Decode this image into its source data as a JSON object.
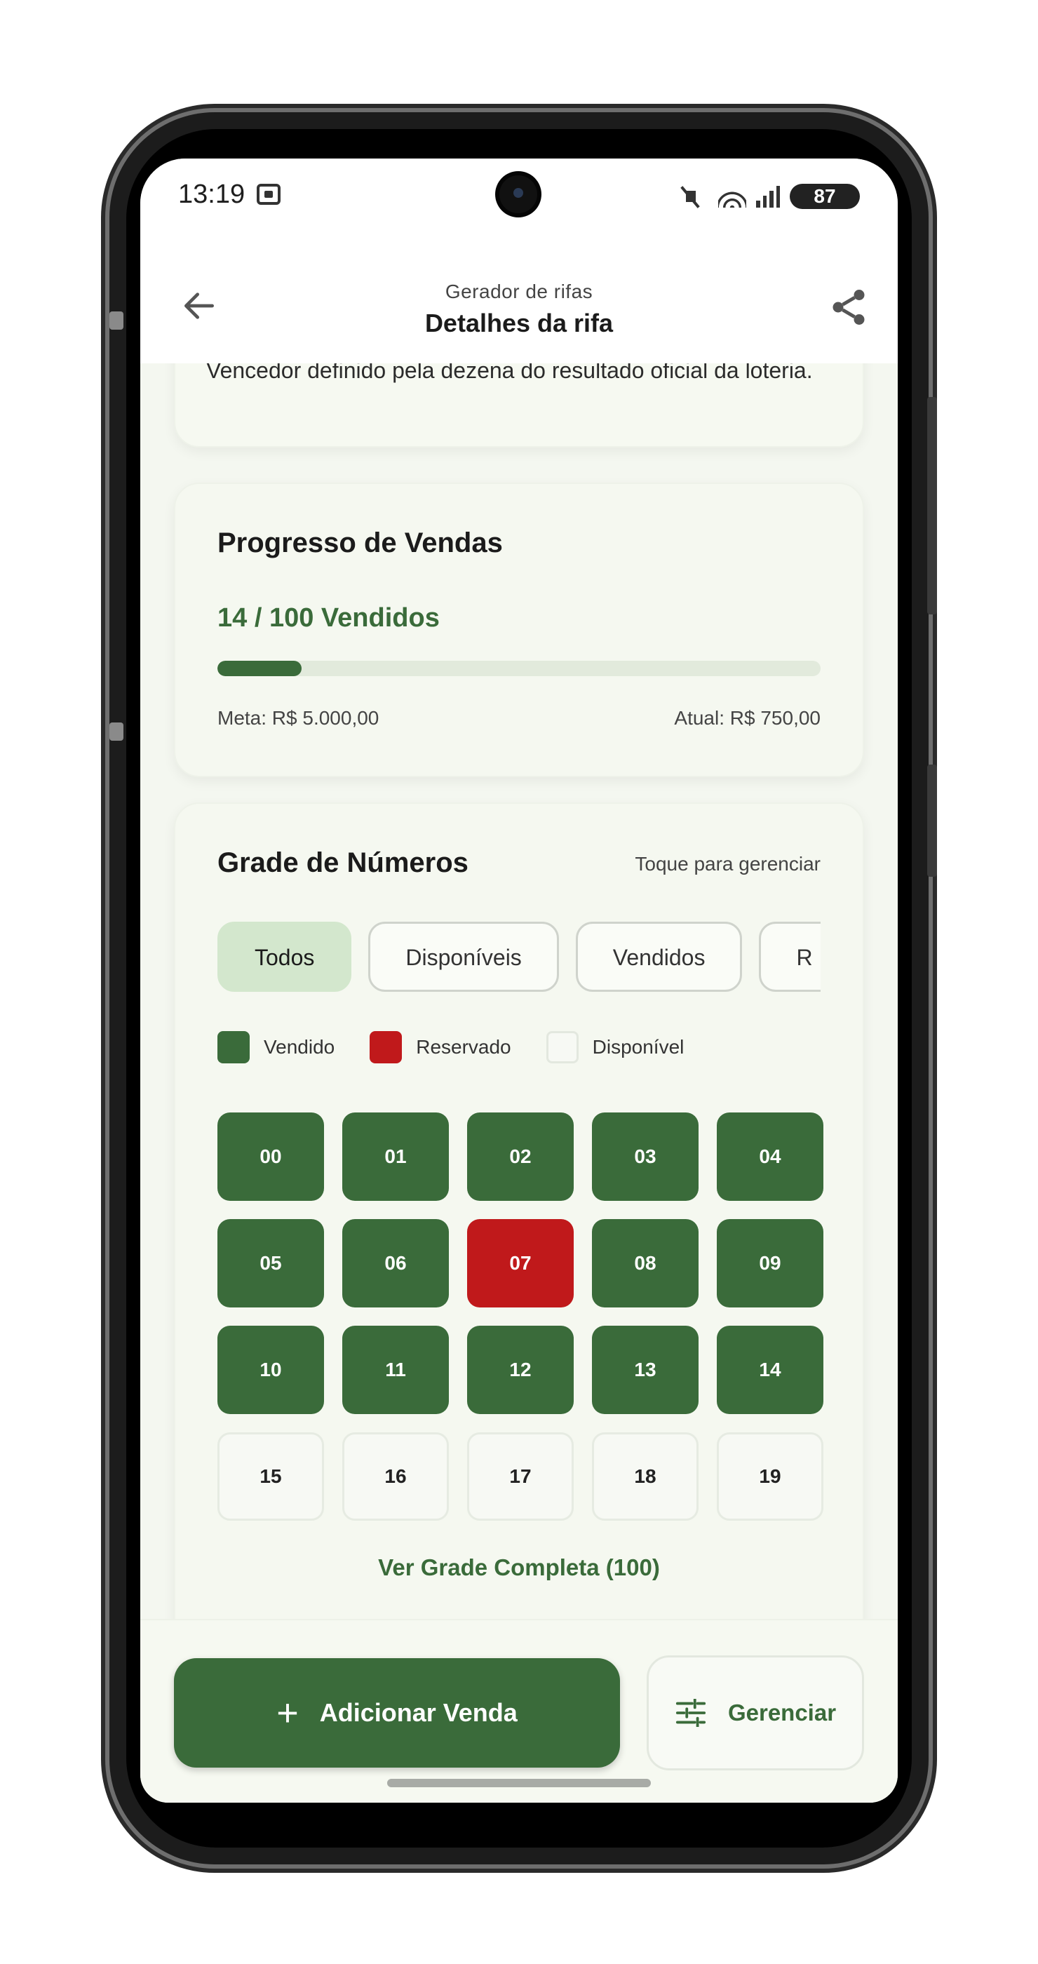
{
  "status_bar": {
    "time": "13:19",
    "battery": "87",
    "icons": [
      "screen-record-icon",
      "mute-icon",
      "wifi-icon",
      "signal-icon",
      "battery-icon"
    ]
  },
  "app_bar": {
    "subtitle": "Gerador de rifas",
    "title": "Detalhes da rifa",
    "back_icon": "arrow-left-icon",
    "share_icon": "share-icon"
  },
  "description": {
    "text": "Vencedor definido pela dezena do resultado oficial da loteria."
  },
  "progress": {
    "title": "Progresso de Vendas",
    "count_label": "14 / 100 Vendidos",
    "sold": 14,
    "total": 100,
    "goal_label": "Meta: R$ 5.000,00",
    "current_label": "Atual: R$ 750,00"
  },
  "grid": {
    "title": "Grade de Números",
    "hint": "Toque para gerenciar",
    "filters": [
      "Todos",
      "Disponíveis",
      "Vendidos",
      "R"
    ],
    "active_filter": "Todos",
    "legend": [
      {
        "label": "Vendido",
        "color": "#3a6b3a"
      },
      {
        "label": "Reservado",
        "color": "#c0191b"
      },
      {
        "label": "Disponível",
        "color": "#f7f9f4"
      }
    ],
    "numbers": [
      {
        "n": "00",
        "status": "sold"
      },
      {
        "n": "01",
        "status": "sold"
      },
      {
        "n": "02",
        "status": "sold"
      },
      {
        "n": "03",
        "status": "sold"
      },
      {
        "n": "04",
        "status": "sold"
      },
      {
        "n": "05",
        "status": "sold"
      },
      {
        "n": "06",
        "status": "sold"
      },
      {
        "n": "07",
        "status": "reserved"
      },
      {
        "n": "08",
        "status": "sold"
      },
      {
        "n": "09",
        "status": "sold"
      },
      {
        "n": "10",
        "status": "sold"
      },
      {
        "n": "11",
        "status": "sold"
      },
      {
        "n": "12",
        "status": "sold"
      },
      {
        "n": "13",
        "status": "sold"
      },
      {
        "n": "14",
        "status": "sold"
      },
      {
        "n": "15",
        "status": "available"
      },
      {
        "n": "16",
        "status": "available"
      },
      {
        "n": "17",
        "status": "available"
      },
      {
        "n": "18",
        "status": "available"
      },
      {
        "n": "19",
        "status": "available"
      }
    ],
    "full_grid_label": "Ver Grade Completa (100)"
  },
  "actions": {
    "add_label": "Adicionar Venda",
    "add_icon": "plus-icon",
    "manage_label": "Gerenciar",
    "manage_icon": "tune-icon"
  },
  "colors": {
    "primary": "#3a6b3a",
    "reserved": "#c0191b",
    "background": "#f4f7f0"
  }
}
